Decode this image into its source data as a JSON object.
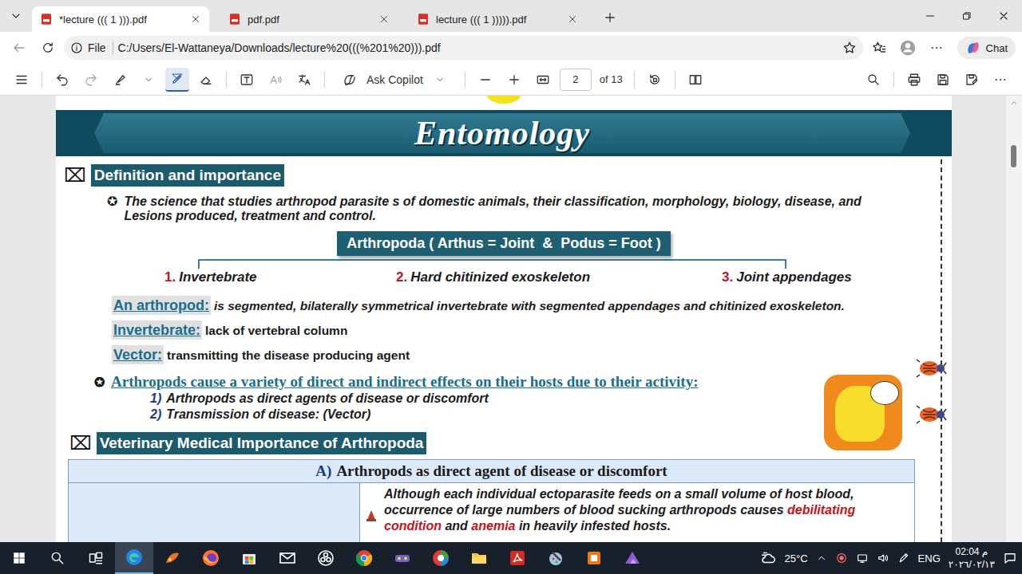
{
  "tabs": [
    {
      "label": "*lecture ((( 1 ))).pdf",
      "selected": true
    },
    {
      "label": "pdf.pdf",
      "selected": false
    },
    {
      "label": "lecture ((( 1 ))))).pdf",
      "selected": false
    }
  ],
  "address_bar": {
    "scheme": "File",
    "url": "C:/Users/El-Wattaneya/Downloads/lecture%20(((%201%20))).pdf"
  },
  "copilot": {
    "label": "Chat"
  },
  "pdf_toolbar": {
    "ask_copilot": "Ask Copilot",
    "page": "2",
    "page_count": "of 13"
  },
  "document": {
    "banner": "Entomology",
    "heading_icon": "⌧",
    "bullet": "✪",
    "section1": {
      "title": "Definition and importance",
      "definition": "The science that studies arthropod parasite s of domestic animals, their classification, morphology, biology, disease, and Lesions produced, treatment and control."
    },
    "arthropoda": "Arthropoda ( Arthus = Joint  &  Podus = Foot )",
    "features": [
      {
        "number": "1.",
        "text": "Invertebrate"
      },
      {
        "number": "2.",
        "text": "Hard chitinized exoskeleton"
      },
      {
        "number": "3.",
        "text": "Joint appendages"
      }
    ],
    "terms": [
      {
        "term": "An arthropod:",
        "text": "is segmented, bilaterally symmetrical invertebrate with segmented appendages and chitinized exoskeleton.",
        "kind": "italic"
      },
      {
        "term": "Invertebrate:",
        "text": "lack of vertebral column",
        "kind": "plain"
      },
      {
        "term": "Vector:",
        "text": "transmitting the disease producing agent",
        "kind": "plain"
      }
    ],
    "effects": {
      "title": "Arthropods cause a variety of direct and indirect effects on their hosts due to their activity:",
      "items": [
        {
          "number": "1)",
          "text": "Arthropods as direct agents of disease or discomfort"
        },
        {
          "number": "2)",
          "text": "Transmission of disease: (Vector)"
        }
      ]
    },
    "section2": {
      "title": "Veterinary Medical Importance of Arthropoda"
    },
    "table": {
      "header": {
        "letter": "A)",
        "title": "Arthropods as direct agent of disease or discomfort"
      },
      "rows": [
        {
          "segments": [
            {
              "text": "Although each individual ectoparasite feeds on a small volume of host blood, occurrence of large numbers of blood sucking arthropods causes ",
              "emphasis": false
            },
            {
              "text": "debilitating condition",
              "emphasis": true
            },
            {
              "text": " and ",
              "emphasis": false
            },
            {
              "text": "anemia",
              "emphasis": true
            },
            {
              "text": " in heavily infested hosts.",
              "emphasis": false
            }
          ]
        }
      ]
    }
  },
  "taskbar": {
    "apps": [
      {
        "kind": "edge",
        "selected": true
      },
      {
        "kind": "paint",
        "selected": false
      },
      {
        "kind": "firefox",
        "selected": false
      },
      {
        "kind": "store",
        "selected": false
      },
      {
        "kind": "mail",
        "selected": false
      },
      {
        "kind": "obs",
        "selected": false
      },
      {
        "kind": "chrome",
        "selected": false
      },
      {
        "kind": "tool",
        "selected": false
      },
      {
        "kind": "colorwheel",
        "selected": false
      },
      {
        "kind": "explorer",
        "selected": false
      },
      {
        "kind": "acrobat",
        "selected": false
      },
      {
        "kind": "brush",
        "selected": false
      },
      {
        "kind": "office",
        "selected": false
      },
      {
        "kind": "photos",
        "selected": false
      }
    ],
    "weather": "25°C",
    "language": "ENG",
    "time": "02:04 م",
    "date": "٢٠٢٦/٠٢/١٣"
  }
}
